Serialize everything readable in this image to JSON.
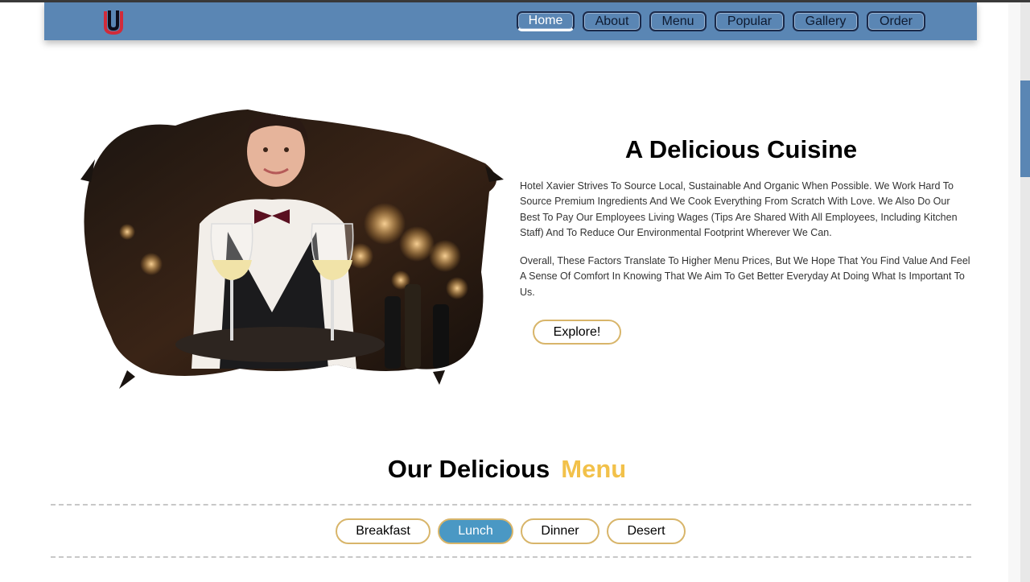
{
  "nav": {
    "links": [
      {
        "label": "Home",
        "active": true
      },
      {
        "label": "About"
      },
      {
        "label": "Menu"
      },
      {
        "label": "Popular"
      },
      {
        "label": "Gallery"
      },
      {
        "label": "Order"
      }
    ]
  },
  "hero": {
    "title": "A Delicious Cuisine",
    "paragraph1": "Hotel Xavier Strives To Source Local, Sustainable And Organic When Possible. We Work Hard To Source Premium Ingredients And We Cook Everything From Scratch With Love. We Also Do Our Best To Pay Our Employees Living Wages (Tips Are Shared With All Employees, Including Kitchen Staff) And To Reduce Our Environmental Footprint Wherever We Can.",
    "paragraph2": "Overall, These Factors Translate To Higher Menu Prices, But We Hope That You Find Value And Feel A Sense Of Comfort In Knowing That We Aim To Get Better Everyday At Doing What Is Important To Us.",
    "cta_label": "Explore!"
  },
  "menu_section": {
    "title_part1": "Our Delicious",
    "title_part2": "Menu",
    "tabs": [
      {
        "label": "Breakfast"
      },
      {
        "label": "Lunch",
        "active": true
      },
      {
        "label": "Dinner"
      },
      {
        "label": "Desert"
      }
    ]
  },
  "colors": {
    "navbar": "#5a86b4",
    "accent_gold": "#f2c14a",
    "tab_active": "#4a98c4",
    "button_border": "#d8b56a"
  }
}
